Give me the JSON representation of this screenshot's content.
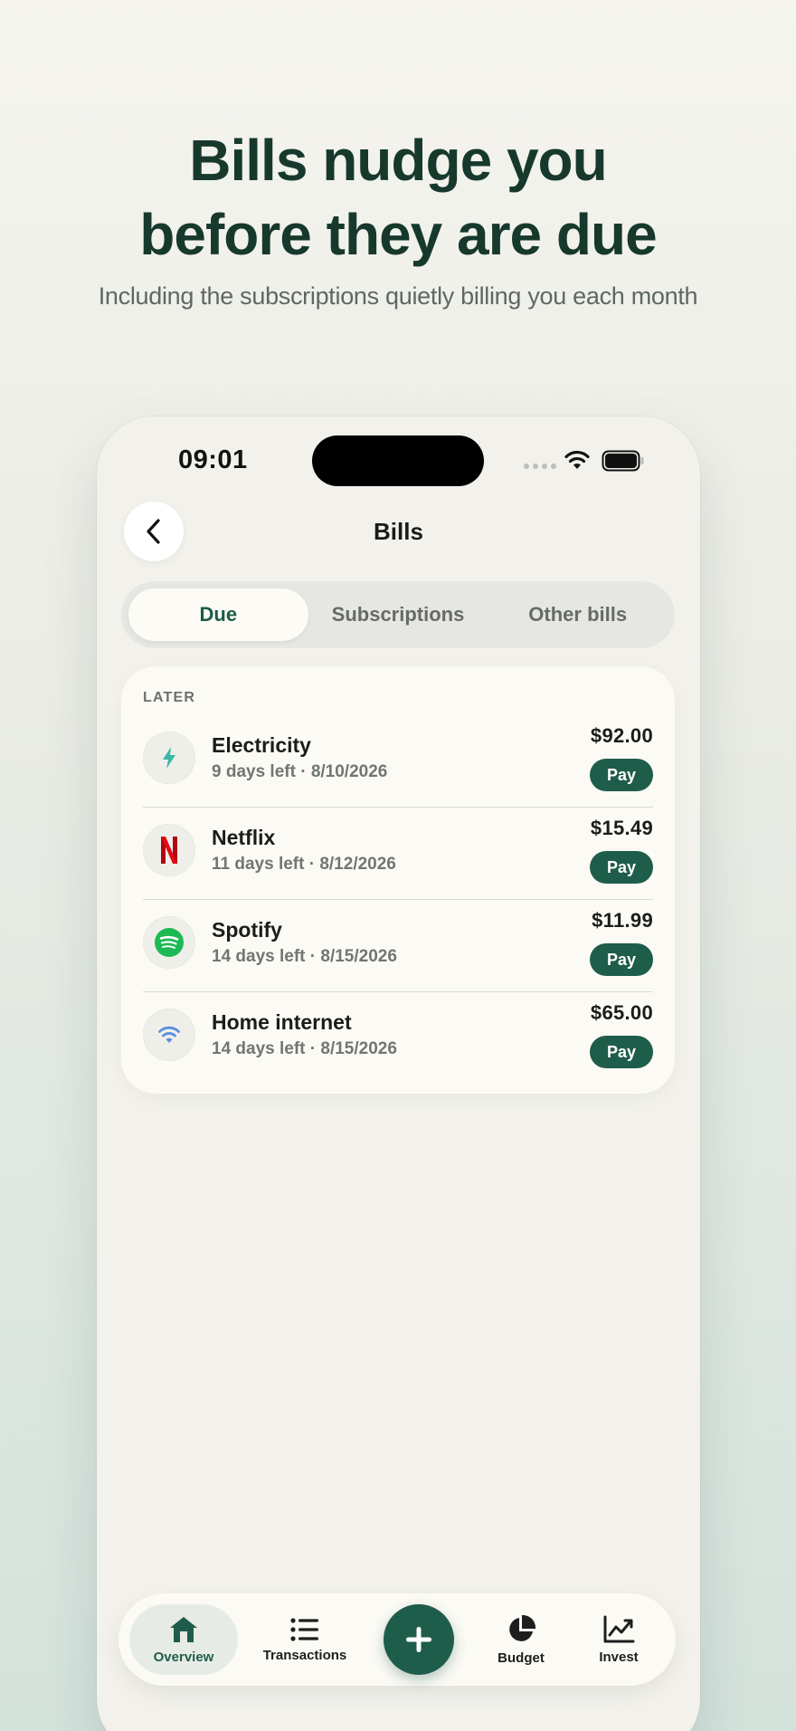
{
  "hero": {
    "title_line1": "Bills nudge you",
    "title_line2": "before they are due",
    "subtitle": "Including the subscriptions quietly billing you each month"
  },
  "status_bar": {
    "time": "09:01"
  },
  "header": {
    "title": "Bills",
    "back_icon": "chevron-left-icon"
  },
  "segments": [
    {
      "label": "Due",
      "active": true
    },
    {
      "label": "Subscriptions",
      "active": false
    },
    {
      "label": "Other bills",
      "active": false
    }
  ],
  "section": {
    "label": "LATER"
  },
  "bills": [
    {
      "name": "Electricity",
      "meta": "9 days left · 8/10/2026",
      "amount": "$92.00",
      "action": "Pay",
      "icon": "lightning-icon",
      "icon_color": "#3bb7a5"
    },
    {
      "name": "Netflix",
      "meta": "11 days left · 8/12/2026",
      "amount": "$15.49",
      "action": "Pay",
      "icon": "netflix-icon",
      "icon_color": "#e50914"
    },
    {
      "name": "Spotify",
      "meta": "14 days left · 8/15/2026",
      "amount": "$11.99",
      "action": "Pay",
      "icon": "spotify-icon",
      "icon_color": "#1db954"
    },
    {
      "name": "Home internet",
      "meta": "14 days left · 8/15/2026",
      "amount": "$65.00",
      "action": "Pay",
      "icon": "wifi-icon",
      "icon_color": "#5b8fe0"
    }
  ],
  "tabbar": {
    "items": [
      {
        "label": "Overview",
        "icon": "home-icon",
        "active": true
      },
      {
        "label": "Transactions",
        "icon": "list-icon",
        "active": false
      },
      {
        "label": "Budget",
        "icon": "pie-chart-icon",
        "active": false
      },
      {
        "label": "Invest",
        "icon": "line-chart-icon",
        "active": false
      }
    ],
    "fab_icon": "plus-icon"
  },
  "colors": {
    "accent": "#1f5d4b",
    "title": "#17392d",
    "background": "#f2f1ec"
  }
}
